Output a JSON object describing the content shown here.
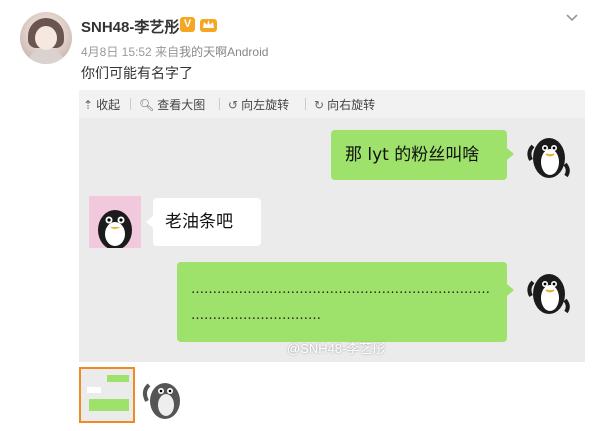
{
  "post": {
    "username": "SNH48-李艺彤",
    "verified_badge": "V",
    "meta_date": "4月8日 15:52",
    "meta_from": "来自",
    "meta_source": "我的天啊Android",
    "text": "你们可能有名字了"
  },
  "toolbar": {
    "collapse": "收起",
    "view_large": "查看大图",
    "rotate_left": "向左旋转",
    "rotate_right": "向右旋转"
  },
  "chat": {
    "msg_1": "那 lyt 的粉丝叫啥",
    "msg_2": "老油条吧",
    "msg_3_line1": "……………………………………………………………",
    "msg_3_line2": "………………………………"
  },
  "watermark": "@SNH48-李艺彤",
  "icons": [
    "chevron-down-icon",
    "collapse-arrow-icon",
    "zoom-icon",
    "rotate-left-icon",
    "rotate-right-icon",
    "crown-badge-icon"
  ],
  "colors": {
    "bubble_green": "#9ee26b",
    "chat_bg": "#ebebeb",
    "badge_orange": "#f5a623",
    "thumb_border": "#f08a24"
  }
}
